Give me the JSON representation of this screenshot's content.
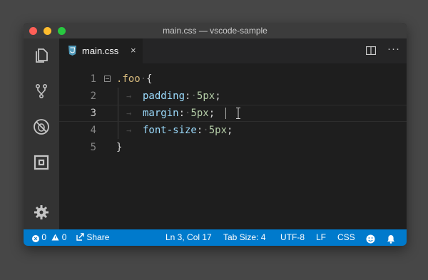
{
  "window": {
    "title": "main.css — vscode-sample"
  },
  "activity_bar": {
    "items": [
      {
        "name": "explorer",
        "icon": "files-icon"
      },
      {
        "name": "source-control",
        "icon": "git-branch-icon"
      },
      {
        "name": "debug",
        "icon": "no-bug-icon"
      },
      {
        "name": "extensions",
        "icon": "extensions-icon"
      }
    ],
    "settings_icon": "gear-icon"
  },
  "tabs": [
    {
      "label": "main.css",
      "icon": "css3-icon",
      "active": true,
      "close_glyph": "×"
    }
  ],
  "editor_actions": {
    "more_glyph": "···"
  },
  "editor": {
    "lines": [
      {
        "number": "1",
        "selector": ".foo",
        "brace": "{"
      },
      {
        "number": "2",
        "property": "padding",
        "colon": ":",
        "value": "5px",
        "semi": ";"
      },
      {
        "number": "3",
        "property": "margin",
        "colon": ":",
        "value": "5px",
        "semi": ";"
      },
      {
        "number": "4",
        "property": "font-size",
        "colon": ":",
        "value": "5px",
        "semi": ";"
      },
      {
        "number": "5",
        "brace": "}"
      }
    ],
    "whitespace_arrow": "→",
    "whitespace_dot": "·",
    "current_line": 3
  },
  "status_bar": {
    "errors": "0",
    "warnings": "0",
    "share": "Share",
    "position": "Ln 3, Col 17",
    "tab_size": "Tab Size: 4",
    "encoding": "UTF-8",
    "eol": "LF",
    "language": "CSS",
    "colors": {
      "background": "#007acc"
    }
  }
}
